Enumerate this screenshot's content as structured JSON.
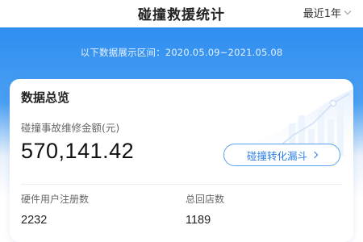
{
  "header": {
    "title": "碰撞救援统计",
    "range_selected": "最近1年"
  },
  "banner": {
    "date_range_text": "以下数据展示区间：2020.05.09~2021.05.08"
  },
  "overview": {
    "title": "数据总览",
    "metric_label": "碰撞事故维修金额(元)",
    "metric_value": "570,141.42",
    "funnel_button_label": "碰撞转化漏斗",
    "hardware_users_label": "硬件用户注册数",
    "hardware_users_value": "2232",
    "total_returns_label": "总回店数",
    "total_returns_value": "1189"
  },
  "colors": {
    "primary": "#2f8ef0",
    "accent_text": "#2f7fe6"
  }
}
